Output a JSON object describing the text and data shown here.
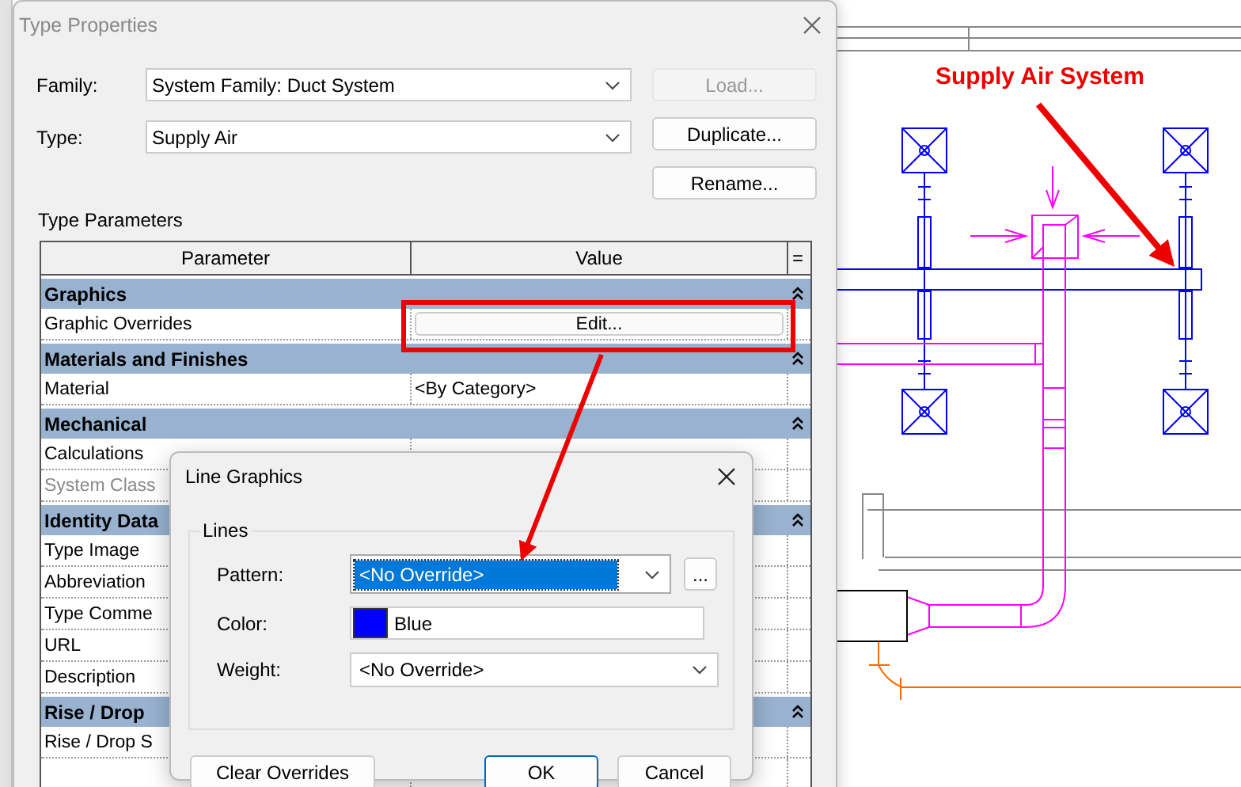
{
  "window": {
    "title": "Type Properties"
  },
  "fields": [
    {
      "label": "Family:",
      "value": "System Family: Duct System"
    },
    {
      "label": "Type:",
      "value": "Supply Air"
    }
  ],
  "buttons": [
    {
      "label": "Load...",
      "disabled": true
    },
    {
      "label": "Duplicate...",
      "disabled": false
    },
    {
      "label": "Rename...",
      "disabled": false
    }
  ],
  "parameters_label": "Type Parameters",
  "table": {
    "columns": [
      "Parameter",
      "Value",
      "="
    ],
    "rows": [
      {
        "kind": "group",
        "label": "Graphics"
      },
      {
        "kind": "button",
        "label": "Graphic Overrides",
        "value": "Edit...",
        "disabled": false
      },
      {
        "kind": "group",
        "label": "Materials and Finishes"
      },
      {
        "kind": "param",
        "label": "Material",
        "value": "<By Category>",
        "disabled": false
      },
      {
        "kind": "group",
        "label": "Mechanical"
      },
      {
        "kind": "param",
        "label": "Calculations",
        "disabled": false
      },
      {
        "kind": "param",
        "label": "System Class",
        "disabled": true
      },
      {
        "kind": "group",
        "label": "Identity Data"
      },
      {
        "kind": "param",
        "label": "Type Image",
        "disabled": false
      },
      {
        "kind": "param",
        "label": "Abbreviation",
        "disabled": false
      },
      {
        "kind": "param",
        "label": "Type Comme",
        "disabled": false
      },
      {
        "kind": "param",
        "label": "URL",
        "disabled": false
      },
      {
        "kind": "param",
        "label": "Description",
        "disabled": false
      },
      {
        "kind": "group",
        "label": "Rise / Drop"
      },
      {
        "kind": "param",
        "label": "Rise / Drop S",
        "disabled": false
      }
    ]
  },
  "dialog": {
    "title": "Line Graphics",
    "group_label": "Lines",
    "fields": [
      {
        "kind": "select",
        "label": "Pattern:",
        "value": "<No Override>",
        "selected": true,
        "more_button": "..."
      },
      {
        "kind": "color",
        "label": "Color:",
        "value": "Blue",
        "color": "#0000ff"
      },
      {
        "kind": "select",
        "label": "Weight:",
        "value": "<No Override>",
        "selected": false
      }
    ],
    "buttons": [
      {
        "label": "Clear Overrides",
        "default": false
      },
      {
        "label": "OK",
        "default": true
      },
      {
        "label": "Cancel",
        "default": false
      }
    ]
  },
  "annotation": "Supply Air System"
}
